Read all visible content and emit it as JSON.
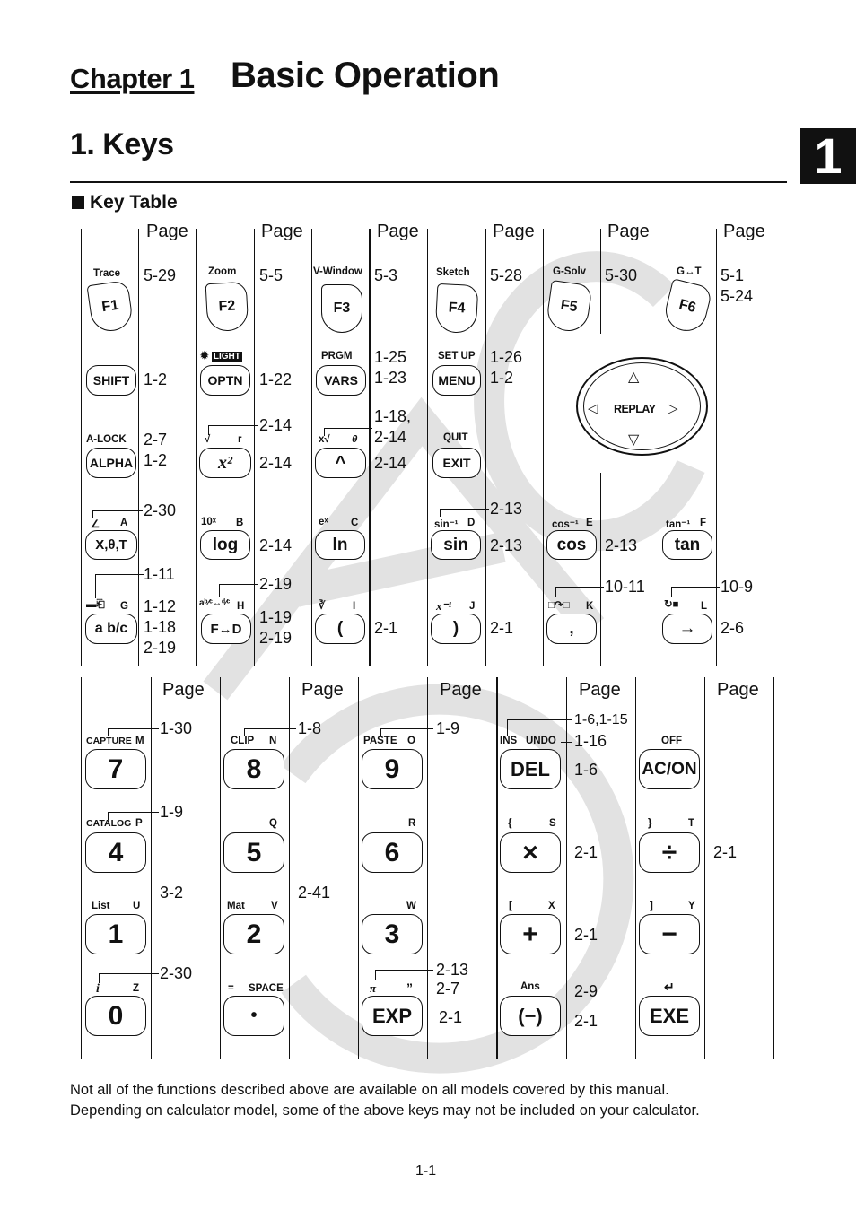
{
  "header": {
    "chapter_label": "Chapter 1",
    "chapter_title": "Basic Operation",
    "section_title": "1. Keys",
    "chapter_tab": "1",
    "subsection_title": "Key Table"
  },
  "watermark": "CASIO",
  "page_header_label": "Page",
  "table1": {
    "fkeys": [
      {
        "key": "F1",
        "label": "Trace",
        "refs": "5-29"
      },
      {
        "key": "F2",
        "label": "Zoom",
        "refs": "5-5"
      },
      {
        "key": "F3",
        "label": "V-Window",
        "refs": "5-3"
      },
      {
        "key": "F4",
        "label": "Sketch",
        "refs": "5-28"
      },
      {
        "key": "F5",
        "label": "G-Solv",
        "refs": "5-30"
      },
      {
        "key": "F6",
        "label": "G↔T",
        "refs": "5-1\n5-24"
      }
    ],
    "row2": [
      {
        "key": "SHIFT",
        "label": "",
        "refs": "1-2"
      },
      {
        "key": "OPTN",
        "label": "LIGHT",
        "refs": "1-22"
      },
      {
        "key": "VARS",
        "label": "PRGM",
        "refs": "1-25\n1-23"
      },
      {
        "key": "MENU",
        "label": "SET UP",
        "refs": "1-26\n1-2"
      }
    ],
    "dpad": {
      "label": "REPLAY",
      "up": "△",
      "down": "▽",
      "left": "◁",
      "right": "▷"
    },
    "row3": [
      {
        "key": "ALPHA",
        "label": "A-LOCK",
        "refs": "2-7\n1-2"
      },
      {
        "key": "x²",
        "label_left": "√",
        "label_right": "r",
        "leader_ref": "2-14",
        "refs": "2-14"
      },
      {
        "key": "^",
        "label_left": "x√",
        "label_right": "θ",
        "leader_ref": "1-18,\n2-14",
        "refs": "2-14"
      },
      {
        "key": "EXIT",
        "label": "QUIT",
        "refs": ""
      }
    ],
    "row4": [
      {
        "key": "X,θ,T",
        "label_left": "∠",
        "label_right": "A",
        "leader_ref": "2-30",
        "refs": ""
      },
      {
        "key": "log",
        "label_left": "10ˣ",
        "label_right": "B",
        "refs": "2-14"
      },
      {
        "key": "ln",
        "label_left": "eˣ",
        "label_right": "C",
        "refs": ""
      },
      {
        "key": "sin",
        "label_left": "sin⁻¹",
        "label_right": "D",
        "leader_ref": "2-13",
        "refs": "2-13"
      },
      {
        "key": "cos",
        "label_left": "cos⁻¹",
        "label_right": "E",
        "refs": "2-13"
      },
      {
        "key": "tan",
        "label_left": "tan⁻¹",
        "label_right": "F",
        "refs": ""
      }
    ],
    "row5": [
      {
        "key": "a b/c",
        "label_left": "▬⎗",
        "label_right": "G",
        "leader_ref": "1-11",
        "refs": "1-12\n1-18\n2-19"
      },
      {
        "key": "F↔D",
        "label_left": "aᵇ⁄ᶜ↔ᵈ⁄ᶜ",
        "label_right": "H",
        "leader_ref": "2-19",
        "refs": "1-19\n2-19"
      },
      {
        "key": "(",
        "label_left": "∛",
        "label_right": "I",
        "refs": "2-1"
      },
      {
        "key": ")",
        "label_left": "x⁻¹",
        "label_right": "J",
        "refs": "2-1"
      },
      {
        "key": ",",
        "label_left": "□↷□",
        "label_right": "K",
        "leader_ref": "10-11",
        "refs": ""
      },
      {
        "key": "→",
        "label_left": "↻■",
        "label_right": "L",
        "leader_ref": "10-9",
        "refs": "2-6"
      }
    ]
  },
  "table2": {
    "rows": [
      [
        {
          "key": "7",
          "label_left": "CAPTURE",
          "label_right": "M",
          "leader_ref": "1-30",
          "refs": ""
        },
        {
          "key": "8",
          "label_left": "CLIP",
          "label_right": "N",
          "leader_ref": "1-8",
          "refs": ""
        },
        {
          "key": "9",
          "label_left": "PASTE",
          "label_right": "O",
          "leader_ref": "1-9",
          "refs": ""
        },
        {
          "key": "DEL",
          "label_left": "INS",
          "label_right": "UNDO",
          "leader_ref": "1-6,1-15",
          "leader_ref2": "1-16",
          "refs": "1-6"
        },
        {
          "key": "AC/ON",
          "label_left": "OFF",
          "label_right": "",
          "refs": ""
        }
      ],
      [
        {
          "key": "4",
          "label_left": "CATALOG",
          "label_right": "P",
          "leader_ref": "1-9",
          "refs": ""
        },
        {
          "key": "5",
          "label_left": "",
          "label_right": "Q",
          "refs": ""
        },
        {
          "key": "6",
          "label_left": "",
          "label_right": "R",
          "refs": ""
        },
        {
          "key": "×",
          "label_left": "{",
          "label_right": "S",
          "refs": "2-1"
        },
        {
          "key": "÷",
          "label_left": "}",
          "label_right": "T",
          "refs": "2-1"
        }
      ],
      [
        {
          "key": "1",
          "label_left": "List",
          "label_right": "U",
          "leader_ref": "3-2",
          "refs": ""
        },
        {
          "key": "2",
          "label_left": "Mat",
          "label_right": "V",
          "leader_ref": "2-41",
          "refs": ""
        },
        {
          "key": "3",
          "label_left": "",
          "label_right": "W",
          "refs": ""
        },
        {
          "key": "+",
          "label_left": "[",
          "label_right": "X",
          "refs": "2-1"
        },
        {
          "key": "−",
          "label_left": "]",
          "label_right": "Y",
          "refs": ""
        }
      ],
      [
        {
          "key": "0",
          "label_left": "i",
          "label_right": "Z",
          "leader_ref": "2-30",
          "refs": ""
        },
        {
          "key": "•",
          "label_left": "=",
          "label_right": "SPACE",
          "refs": ""
        },
        {
          "key": "EXP",
          "label_left": "π",
          "label_right": "”",
          "leader_ref": "2-13",
          "leader_ref2": "2-7",
          "refs": "2-1"
        },
        {
          "key": "(−)",
          "label_left": "Ans",
          "label_right": "",
          "refs": "2-9\n2-1"
        },
        {
          "key": "EXE",
          "label_left": "↵",
          "label_right": "",
          "refs": ""
        }
      ]
    ]
  },
  "footer": {
    "note_line1": "Not all of the functions described above are available on all models covered by this manual.",
    "note_line2": "Depending on calculator model, some of the above keys may not be included on your calculator.",
    "page_number": "1-1"
  }
}
